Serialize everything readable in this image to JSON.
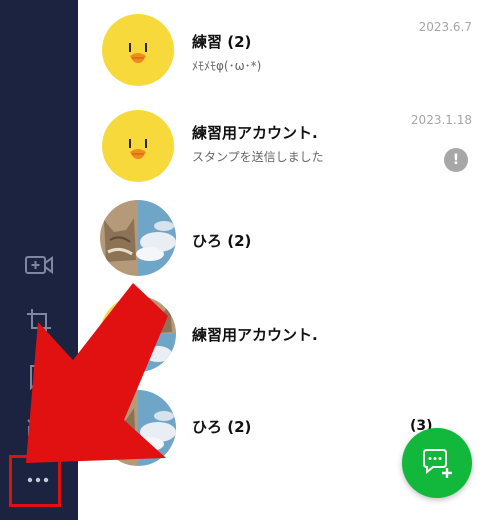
{
  "chats": [
    {
      "name": "練習",
      "count": "(2)",
      "message": "ﾒﾓﾒﾓφ(･ω･*)",
      "date": "2023.6.7"
    },
    {
      "name": "練習用アカウント.",
      "message": "スタンプを送信しました",
      "date": "2023.1.18",
      "alert": "!"
    },
    {
      "name": "ひろ",
      "count": "(2)"
    },
    {
      "name": "練習用アカウント."
    },
    {
      "name": "ひろ",
      "count": "(2)",
      "badge": "(3)"
    }
  ],
  "sidebar": {
    "icons": [
      "video-call-icon",
      "crop-icon",
      "bookmark-icon",
      "mute-icon",
      "more-icon"
    ]
  },
  "fab": {
    "icon": "new-chat-icon"
  },
  "colors": {
    "sidebar": "#1c2341",
    "fab": "#12b83b",
    "highlight": "#e01010",
    "avatar_yellow": "#f7d93c"
  }
}
